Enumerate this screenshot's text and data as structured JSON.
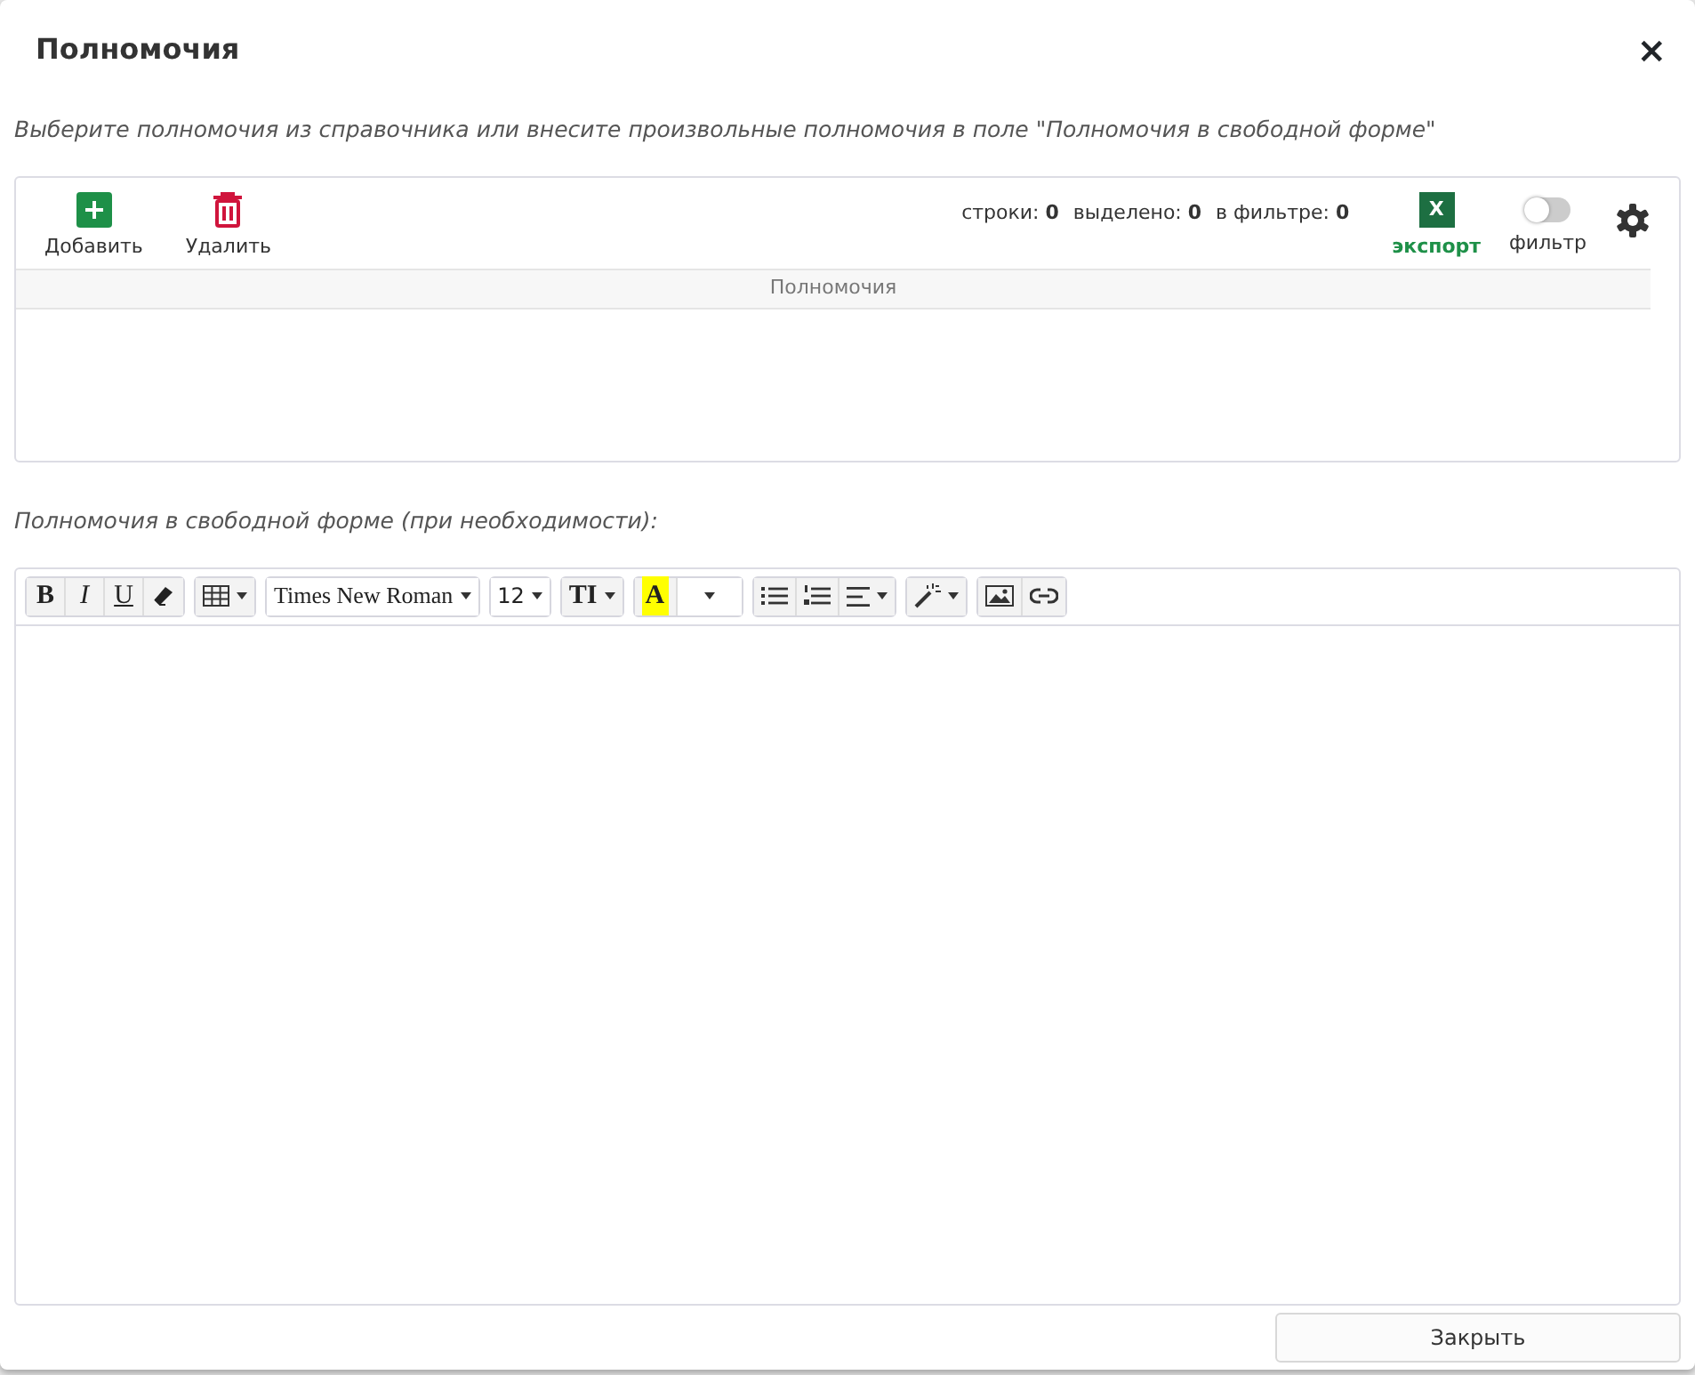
{
  "window": {
    "title": "Полномочия",
    "close": "×"
  },
  "hint": "Выберите полномочия из справочника или внесите произвольные полномочия в поле \"Полномочия в свободной форме\"",
  "grid": {
    "actions": [
      {
        "kind": "add",
        "label": "Добавить"
      },
      {
        "kind": "delete",
        "label": "Удалить"
      }
    ],
    "counters": [
      {
        "label": "строки:",
        "value": "0"
      },
      {
        "label": "выделено:",
        "value": "0"
      },
      {
        "label": "в фильтре:",
        "value": "0"
      }
    ],
    "export": {
      "icon": "X",
      "label": "экспорт"
    },
    "filter": {
      "label": "фильтр",
      "on": false
    },
    "columns": [
      "Полномочия"
    ]
  },
  "free_form_label": "Полномочия в свободной форме (при необходимости):",
  "editor": {
    "groups": [
      [
        {
          "kind": "bold",
          "text": "B"
        },
        {
          "kind": "italic",
          "text": "I"
        },
        {
          "kind": "underline",
          "text": "U"
        },
        {
          "kind": "eraser"
        }
      ],
      [
        {
          "kind": "table"
        }
      ],
      [
        {
          "kind": "font",
          "text": "Times New Roman"
        }
      ],
      [
        {
          "kind": "select",
          "text": "12"
        }
      ],
      [
        {
          "kind": "textsize",
          "text": "TI"
        }
      ],
      [
        {
          "kind": "highlight",
          "text": "A",
          "color": "#ffff00"
        },
        {
          "kind": "caretonly"
        }
      ],
      [
        {
          "kind": "ul"
        },
        {
          "kind": "ol"
        },
        {
          "kind": "align"
        }
      ],
      [
        {
          "kind": "magic"
        }
      ],
      [
        {
          "kind": "image"
        },
        {
          "kind": "link"
        }
      ]
    ]
  },
  "footer": {
    "button": "Закрыть"
  }
}
